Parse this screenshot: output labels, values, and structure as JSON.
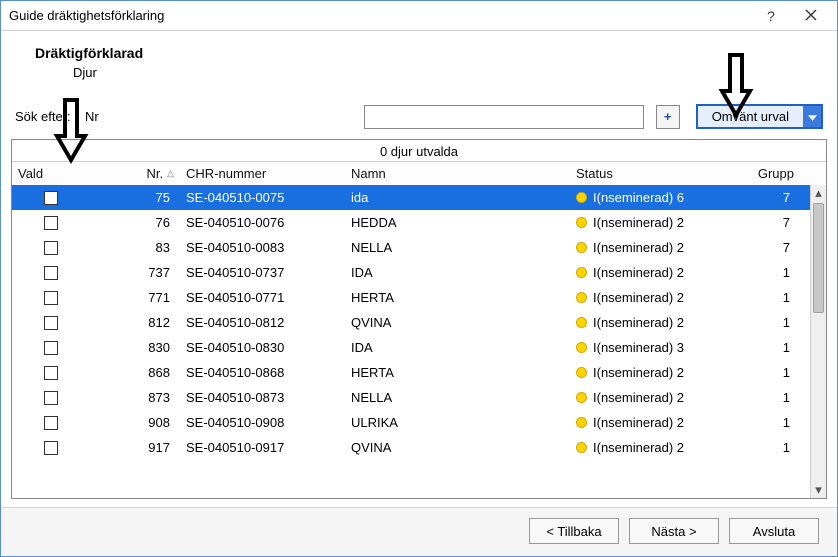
{
  "window": {
    "title": "Guide dräktighetsförklaring"
  },
  "header": {
    "title": "Dräktigförklarad",
    "subtitle": "Djur"
  },
  "search": {
    "label": "Sök efter:",
    "field_label": "Nr",
    "value": "",
    "placeholder": "",
    "plus_label": "+",
    "invert_label": "Omvänt urval"
  },
  "grid": {
    "caption": "0 djur utvalda",
    "columns": {
      "vald": "Vald",
      "nr": "Nr.",
      "chr": "CHR-nummer",
      "namn": "Namn",
      "status": "Status",
      "grupp": "Grupp"
    },
    "rows": [
      {
        "nr": "75",
        "chr": "SE-040510-0075",
        "namn": "ida",
        "status": "I(nseminerad) 6",
        "grupp": "7",
        "selected": true
      },
      {
        "nr": "76",
        "chr": "SE-040510-0076",
        "namn": "HEDDA",
        "status": "I(nseminerad) 2",
        "grupp": "7"
      },
      {
        "nr": "83",
        "chr": "SE-040510-0083",
        "namn": "NELLA",
        "status": "I(nseminerad) 2",
        "grupp": "7"
      },
      {
        "nr": "737",
        "chr": "SE-040510-0737",
        "namn": "IDA",
        "status": "I(nseminerad) 2",
        "grupp": "1"
      },
      {
        "nr": "771",
        "chr": "SE-040510-0771",
        "namn": "HERTA",
        "status": "I(nseminerad) 2",
        "grupp": "1"
      },
      {
        "nr": "812",
        "chr": "SE-040510-0812",
        "namn": "QVINA",
        "status": "I(nseminerad) 2",
        "grupp": "1"
      },
      {
        "nr": "830",
        "chr": "SE-040510-0830",
        "namn": "IDA",
        "status": "I(nseminerad) 3",
        "grupp": "1"
      },
      {
        "nr": "868",
        "chr": "SE-040510-0868",
        "namn": "HERTA",
        "status": "I(nseminerad) 2",
        "grupp": "1"
      },
      {
        "nr": "873",
        "chr": "SE-040510-0873",
        "namn": "NELLA",
        "status": "I(nseminerad) 2",
        "grupp": "1"
      },
      {
        "nr": "908",
        "chr": "SE-040510-0908",
        "namn": "ULRIKA",
        "status": "I(nseminerad) 2",
        "grupp": "1"
      },
      {
        "nr": "917",
        "chr": "SE-040510-0917",
        "namn": "QVINA",
        "status": "I(nseminerad) 2",
        "grupp": "1"
      }
    ]
  },
  "footer": {
    "back": "< Tillbaka",
    "next": "Nästa >",
    "finish": "Avsluta"
  }
}
